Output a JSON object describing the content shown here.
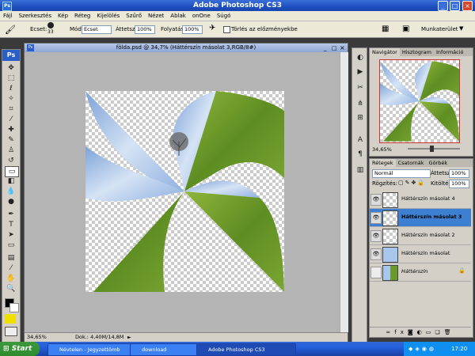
{
  "app": {
    "title": "Adobe Photoshop CS3"
  },
  "menu": [
    "Fájl",
    "Szerkesztés",
    "Kép",
    "Réteg",
    "Kijelölés",
    "Szűrő",
    "Nézet",
    "Ablak",
    "onOne",
    "Súgó"
  ],
  "options": {
    "brush_label": "Ecset:",
    "brush_size": "33",
    "mode_label": "Mód:",
    "mode_value": "Ecset",
    "opacity_label": "Áttetsz.:",
    "opacity_value": "100%",
    "flow_label": "Folyatás:",
    "flow_value": "100%",
    "erase_history_label": "Törlés az előzményekbe",
    "workspace_label": "Munkaterület"
  },
  "document": {
    "title": "földa.psd @ 34,7% (Háttérszín másolat 3,RGB/8#)",
    "zoom": "34,65%",
    "doc_info": "Dok.: 4,40M/14,8M"
  },
  "navigator": {
    "tabs": [
      "Navigátor",
      "Hisztogram",
      "Információ"
    ],
    "zoom": "34,65%"
  },
  "layers": {
    "tabs": [
      "Rétegek",
      "Csatornák",
      "Görbék"
    ],
    "blend_mode": "Normál",
    "opacity_label": "Áttetsz.:",
    "opacity_value": "100%",
    "lock_label": "Rögzítés:",
    "fill_label": "Kitöltés:",
    "fill_value": "100%",
    "items": [
      {
        "name": "Háttérszín másolat 4",
        "selected": false
      },
      {
        "name": "Háttérszín másolat 3",
        "selected": true
      },
      {
        "name": "Háttérszín másolat 2",
        "selected": false
      },
      {
        "name": "Háttérszín másolat",
        "selected": false
      },
      {
        "name": "Háttérszín",
        "selected": false
      }
    ]
  },
  "taskbar": {
    "start_label": "Start",
    "tasks": [
      "Névtelen - Jegyzettömb",
      "download",
      "Adobe Photoshop CS3"
    ],
    "clock": "17:20"
  },
  "colors": {
    "accent": "#245edb",
    "sky": "#a9c6ec",
    "grass": "#6c9a2a",
    "selected_layer": "#3d7fd1"
  }
}
